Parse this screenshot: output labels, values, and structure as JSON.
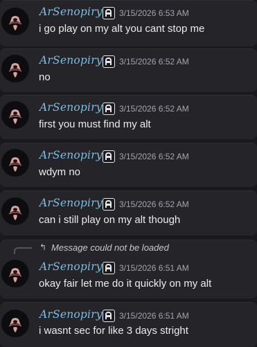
{
  "messages": [
    {
      "author": "ArSenopiryt",
      "timestamp": "3/15/2026 6:53 AM",
      "text": "i go play on my alt you cant stop me"
    },
    {
      "author": "ArSenopiryt",
      "timestamp": "3/15/2026 6:52 AM",
      "text": "no"
    },
    {
      "author": "ArSenopiryt",
      "timestamp": "3/15/2026 6:52 AM",
      "text": "first you must find my alt"
    },
    {
      "author": "ArSenopiryt",
      "timestamp": "3/15/2026 6:52 AM",
      "text": "wdym no"
    },
    {
      "author": "ArSenopiryt",
      "timestamp": "3/15/2026 6:52 AM",
      "text": "can i still play on my alt though"
    },
    {
      "author": "ArSenopiryt",
      "timestamp": "3/15/2026 6:51 AM",
      "text": "okay fair let me do it quickly on my alt",
      "reply_text": "Message could not be loaded"
    },
    {
      "author": "ArSenopiryt",
      "timestamp": "3/15/2026 6:51 AM",
      "text": "i wasnt sec for like 3 days stright"
    }
  ],
  "icons": {
    "avatar": "skull-avatar",
    "tag": "guild-tag-icon",
    "reply": "reply-arrow-icon"
  },
  "colors": {
    "background": "#1a1a1e",
    "message_background": "#242429",
    "author_name": "#7dbfe3",
    "timestamp": "#a5a5ad",
    "message_text": "#ededf0"
  }
}
